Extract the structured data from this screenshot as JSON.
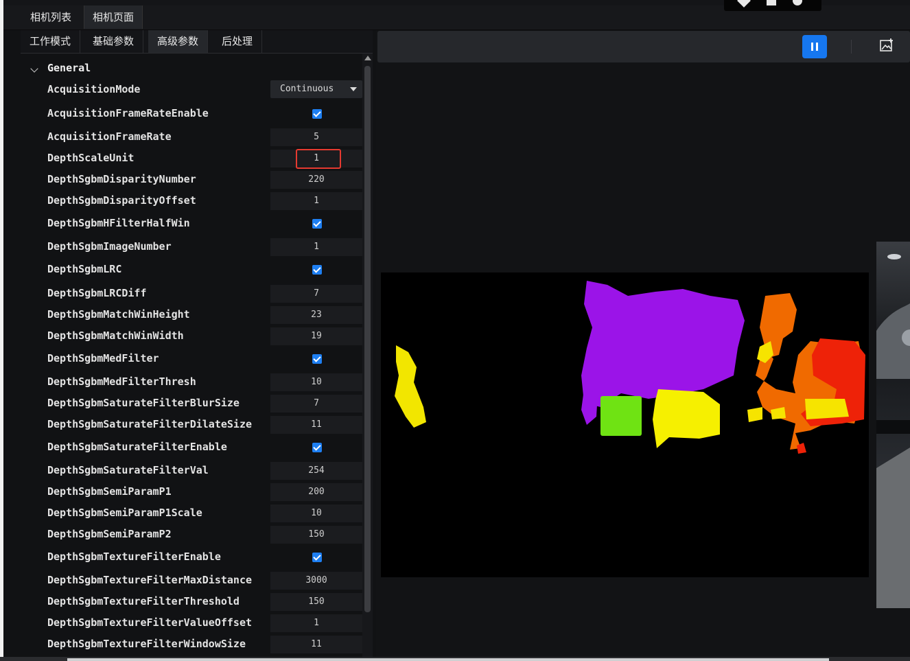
{
  "top_tabs": [
    {
      "label": "相机列表",
      "active": false
    },
    {
      "label": "相机页面",
      "active": true
    }
  ],
  "sub_tabs": [
    {
      "label": "工作模式",
      "active": false
    },
    {
      "label": "基础参数",
      "active": false
    },
    {
      "label": "高级参数",
      "active": true
    },
    {
      "label": "后处理",
      "active": false
    }
  ],
  "group": {
    "title": "General",
    "expanded": true
  },
  "params": [
    {
      "name": "AcquisitionMode",
      "kind": "select",
      "value": "Continuous"
    },
    {
      "name": "AcquisitionFrameRateEnable",
      "kind": "check",
      "value": ""
    },
    {
      "name": "AcquisitionFrameRate",
      "kind": "num",
      "value": "5"
    },
    {
      "name": "DepthScaleUnit",
      "kind": "num",
      "value": "1"
    },
    {
      "name": "DepthSgbmDisparityNumber",
      "kind": "num",
      "value": "220"
    },
    {
      "name": "DepthSgbmDisparityOffset",
      "kind": "num",
      "value": "1"
    },
    {
      "name": "DepthSgbmHFilterHalfWin",
      "kind": "check",
      "value": ""
    },
    {
      "name": "DepthSgbmImageNumber",
      "kind": "num",
      "value": "1"
    },
    {
      "name": "DepthSgbmLRC",
      "kind": "check",
      "value": ""
    },
    {
      "name": "DepthSgbmLRCDiff",
      "kind": "num",
      "value": "7"
    },
    {
      "name": "DepthSgbmMatchWinHeight",
      "kind": "num",
      "value": "23"
    },
    {
      "name": "DepthSgbmMatchWinWidth",
      "kind": "num",
      "value": "19"
    },
    {
      "name": "DepthSgbmMedFilter",
      "kind": "check",
      "value": ""
    },
    {
      "name": "DepthSgbmMedFilterThresh",
      "kind": "num",
      "value": "10"
    },
    {
      "name": "DepthSgbmSaturateFilterBlurSize",
      "kind": "num",
      "value": "7"
    },
    {
      "name": "DepthSgbmSaturateFilterDilateSize",
      "kind": "num",
      "value": "11"
    },
    {
      "name": "DepthSgbmSaturateFilterEnable",
      "kind": "check",
      "value": ""
    },
    {
      "name": "DepthSgbmSaturateFilterVal",
      "kind": "num",
      "value": "254"
    },
    {
      "name": "DepthSgbmSemiParamP1",
      "kind": "num",
      "value": "200"
    },
    {
      "name": "DepthSgbmSemiParamP1Scale",
      "kind": "num",
      "value": "10"
    },
    {
      "name": "DepthSgbmSemiParamP2",
      "kind": "num",
      "value": "150"
    },
    {
      "name": "DepthSgbmTextureFilterEnable",
      "kind": "check",
      "value": ""
    },
    {
      "name": "DepthSgbmTextureFilterMaxDistance",
      "kind": "num",
      "value": "3000"
    },
    {
      "name": "DepthSgbmTextureFilterThreshold",
      "kind": "num",
      "value": "150"
    },
    {
      "name": "DepthSgbmTextureFilterValueOffset",
      "kind": "num",
      "value": "1"
    },
    {
      "name": "DepthSgbmTextureFilterWindowSize",
      "kind": "num",
      "value": "11"
    }
  ],
  "toolbar": {
    "pause_icon": "pause-icon",
    "save_icon": "save-image-icon",
    "accent": "#1677ef"
  },
  "colors": {
    "check": "#1e7ff2",
    "highlight": "#e63a30"
  }
}
